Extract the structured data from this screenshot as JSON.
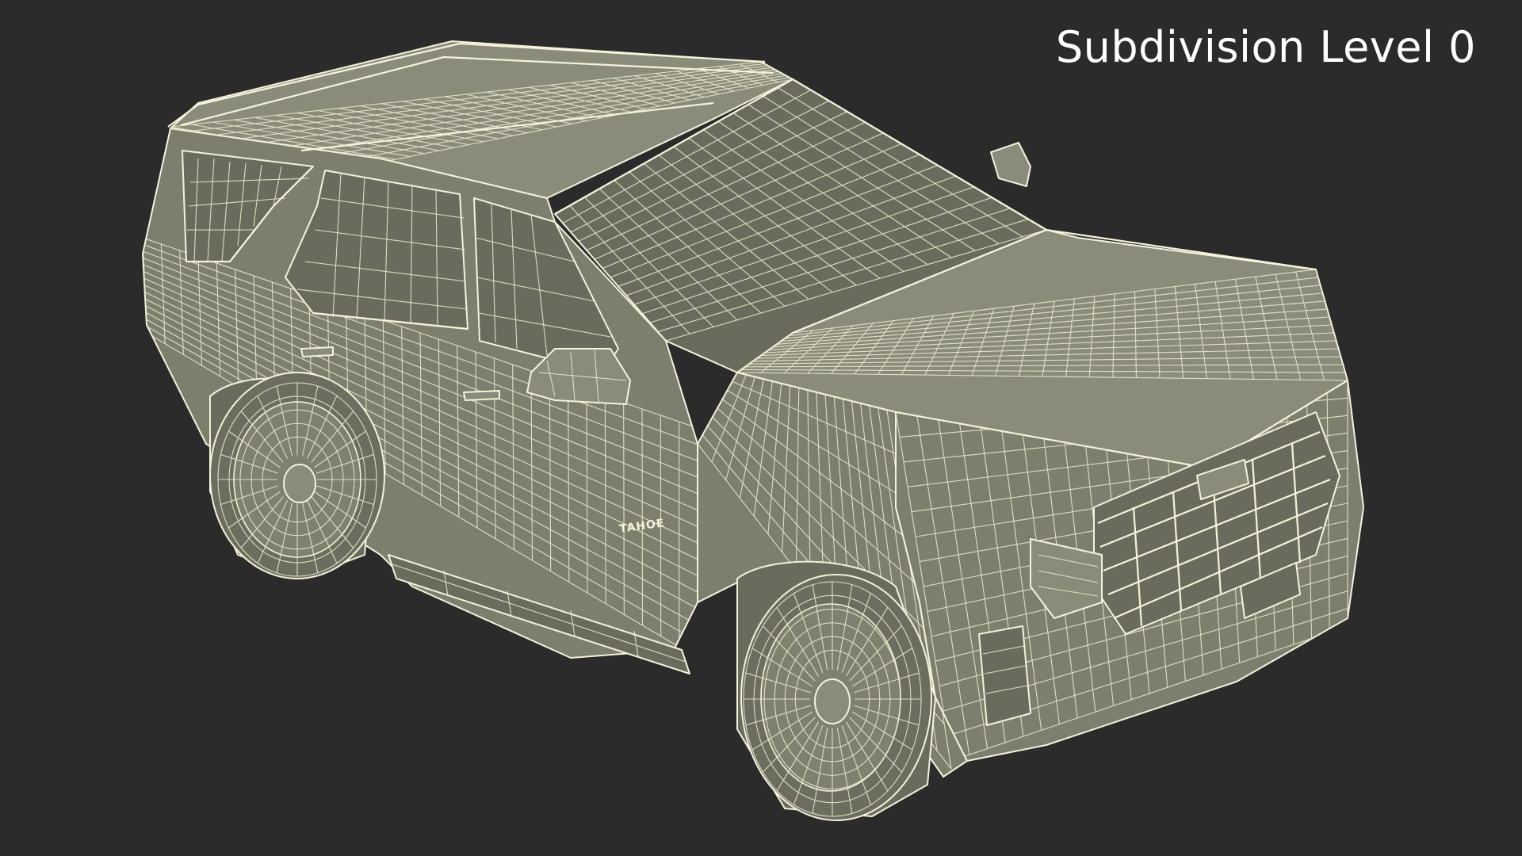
{
  "viewport": {
    "subdivision_label": "Subdivision Level 0",
    "background_color": "#2b2b2b",
    "wire_color": "#f4f2dc",
    "surface_color": "#7d7e6e"
  },
  "model": {
    "badge_text": "TAHOE"
  }
}
